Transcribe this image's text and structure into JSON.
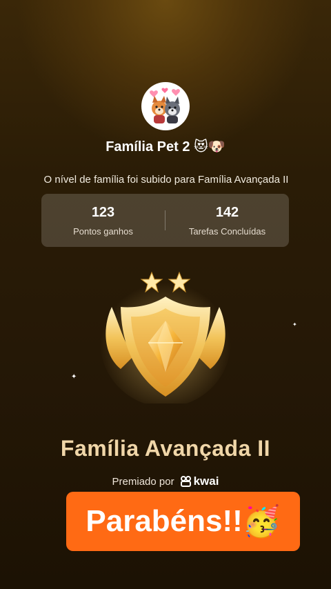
{
  "family": {
    "name": "Família Pet 2",
    "emojis": "😻🐶"
  },
  "message": "O nível de família foi subido para Família Avançada II",
  "stats": [
    {
      "value": "123",
      "label": "Pontos ganhos"
    },
    {
      "value": "142",
      "label": "Tarefas Concluídas"
    }
  ],
  "badge": {
    "level_name": "Família Avançada II",
    "stars": 2
  },
  "award": {
    "prefix": "Premiado por",
    "brand": "kwai"
  },
  "congrats": {
    "text": "Parabéns!!",
    "emoji": "🥳"
  },
  "colors": {
    "accent_orange": "#ff6a14",
    "gold": "#f0d6a8",
    "background": "#2a1c06"
  }
}
